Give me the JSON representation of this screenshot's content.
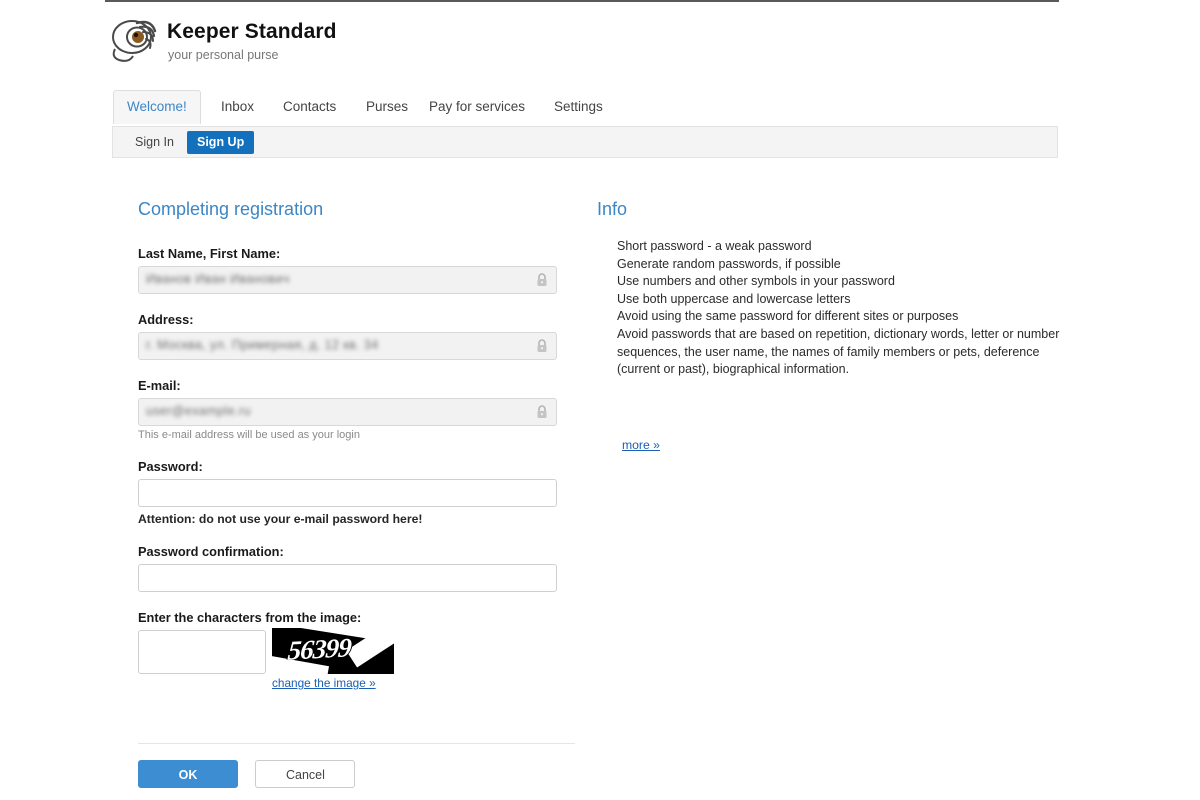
{
  "brand": {
    "title": "Keeper Standard",
    "tagline": "your personal purse",
    "logo_icon": "snail-eye-logo"
  },
  "nav": {
    "items": [
      {
        "label": "Welcome!",
        "active": true
      },
      {
        "label": "Inbox",
        "active": false
      },
      {
        "label": "Contacts",
        "active": false
      },
      {
        "label": "Purses",
        "active": false
      },
      {
        "label": "Pay for services",
        "active": false
      },
      {
        "label": "Settings",
        "active": false
      }
    ]
  },
  "subnav": {
    "items": [
      {
        "label": "Sign In",
        "active": false
      },
      {
        "label": "Sign Up",
        "active": true
      }
    ]
  },
  "form": {
    "title": "Completing registration",
    "fields": {
      "name": {
        "label": "Last Name, First Name:",
        "value": "Иванов Иван Иванович",
        "locked": true,
        "lock_icon": "lock-icon"
      },
      "address": {
        "label": "Address:",
        "value": "г. Москва, ул. Примерная, д. 12 кв. 34",
        "locked": true,
        "lock_icon": "lock-icon"
      },
      "email": {
        "label": "E-mail:",
        "value": "user@example.ru",
        "locked": true,
        "lock_icon": "lock-icon",
        "help": "This e-mail address will be used as your login"
      },
      "password": {
        "label": "Password:",
        "value": "",
        "warning": "Attention: do not use your e-mail password here!"
      },
      "password_confirmation": {
        "label": "Password confirmation:",
        "value": ""
      },
      "captcha": {
        "label": "Enter the characters from the image:",
        "value": "",
        "image_text": "56399",
        "change_link": "change the image »"
      }
    },
    "buttons": {
      "ok": "OK",
      "cancel": "Cancel"
    }
  },
  "info": {
    "title": "Info",
    "lines": [
      "Short password - a weak password",
      "Generate random passwords, if possible",
      "Use numbers and other symbols in your password",
      "Use both uppercase and lowercase letters",
      "Avoid using the same password for different sites or purposes",
      "Avoid passwords that are based on repetition, dictionary words, letter or number sequences, the user name, the names of family members or pets, deference (current or past), biographical information."
    ],
    "more_link": "more »"
  },
  "colors": {
    "accent": "#3b86c6",
    "primary_button": "#3d8dd3",
    "active_tab": "#1270bd",
    "link": "#1a5fb4"
  }
}
